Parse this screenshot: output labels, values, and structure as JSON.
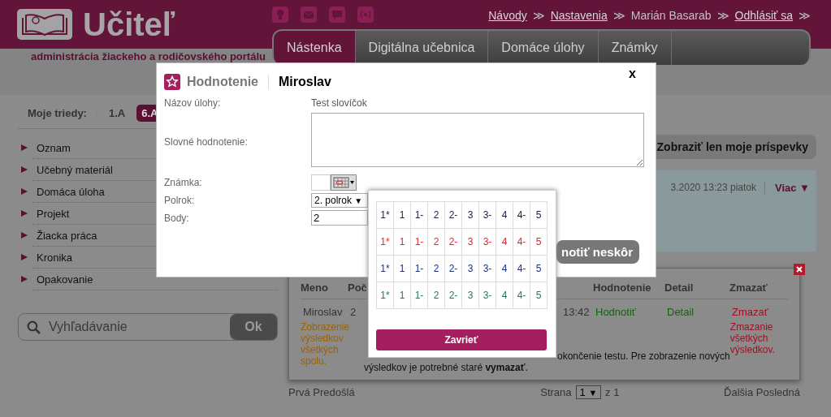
{
  "header": {
    "logo_text": "Učiteľ",
    "tagline": "administrácia žiackeho a rodičovského portálu",
    "link_separator": "≫",
    "top_links": [
      {
        "label": "Návody",
        "link": true
      },
      {
        "label": "Nastavenia",
        "link": true
      },
      {
        "label": "Marián Basarab",
        "link": false
      },
      {
        "label": "Odhlásiť sa",
        "link": true
      }
    ],
    "tabs": [
      {
        "label": "Nástenka",
        "selected": true
      },
      {
        "label": "Digitálna učebnica",
        "selected": false
      },
      {
        "label": "Domáce úlohy",
        "selected": false
      },
      {
        "label": "Známky",
        "selected": false
      }
    ]
  },
  "classes": {
    "label": "Moje triedy:",
    "items": [
      {
        "label": "1.A",
        "selected": false
      },
      {
        "label": "6.A",
        "selected": true
      }
    ]
  },
  "sidebar": {
    "items": [
      "Oznam",
      "Učebný materiál",
      "Domáca úloha",
      "Projekt",
      "Žiacka práca",
      "Kronika",
      "Opakovanie"
    ]
  },
  "search": {
    "placeholder": "Vyhľadávanie",
    "button": "Ok"
  },
  "filter_button": "Zobraziť len moje príspevky",
  "post": {
    "date": "3.2020 13:23 piatok",
    "more": "Viac ▼"
  },
  "results": {
    "columns": [
      "Meno",
      "Poč",
      "Hodnotenie",
      "Detail",
      "Zmazať"
    ],
    "row": {
      "name": "Miroslav",
      "count": "2",
      "time": "13:42",
      "grade": "Hodnotiť",
      "detail": "Detail",
      "delete": "Zmazať"
    },
    "show_all": "Zobrazenie výsledkov všetkých spolu.",
    "delete_all": "Zmazanie všetkých výsledkov.",
    "message": [
      "okončenie testu. Pre zobrazenie nových",
      "výsledkov je potrebné staré **vymazať**."
    ]
  },
  "pagination": {
    "first_prev": "Prvá Predošlá",
    "page_label": "Strana",
    "page": "1",
    "page_arrow": "▼",
    "of": "z 1",
    "next_last": "Ďalšia Posledná"
  },
  "modal": {
    "title": "Hodnotenie",
    "student": "Miroslav",
    "close": "x",
    "later_button": "notiť neskôr",
    "fields": [
      {
        "kind": "text",
        "label": "Názov úlohy:",
        "value": "Test slovíčok"
      },
      {
        "kind": "textarea",
        "label": "Slovné hodnotenie:"
      },
      {
        "kind": "grade",
        "label": "Známka:"
      },
      {
        "kind": "select",
        "label": "Polrok:",
        "value": "2. polrok",
        "arrow": "▼"
      },
      {
        "kind": "input",
        "label": "Body:",
        "value": "2"
      }
    ]
  },
  "grades": {
    "close_button": "Zavrieť",
    "rows": [
      {
        "color": "#1c1c3c",
        "cells": [
          "1*",
          "1",
          "1-",
          "2",
          "2-",
          "3",
          "3-",
          "4",
          "4-",
          "5"
        ]
      },
      {
        "color": "#e8202c",
        "cells": [
          "1*",
          "1",
          "1-",
          "2",
          "2-",
          "3",
          "3-",
          "4",
          "4-",
          "5"
        ]
      },
      {
        "color": "#1e2e80",
        "cells": [
          "1*",
          "1",
          "1-",
          "2",
          "2-",
          "3",
          "3-",
          "4",
          "4-",
          "5"
        ]
      },
      {
        "color": "#1e8050",
        "cells": [
          "1*",
          "1",
          "1-",
          "2",
          "2-",
          "3",
          "3-",
          "4",
          "4-",
          "5"
        ]
      }
    ]
  }
}
